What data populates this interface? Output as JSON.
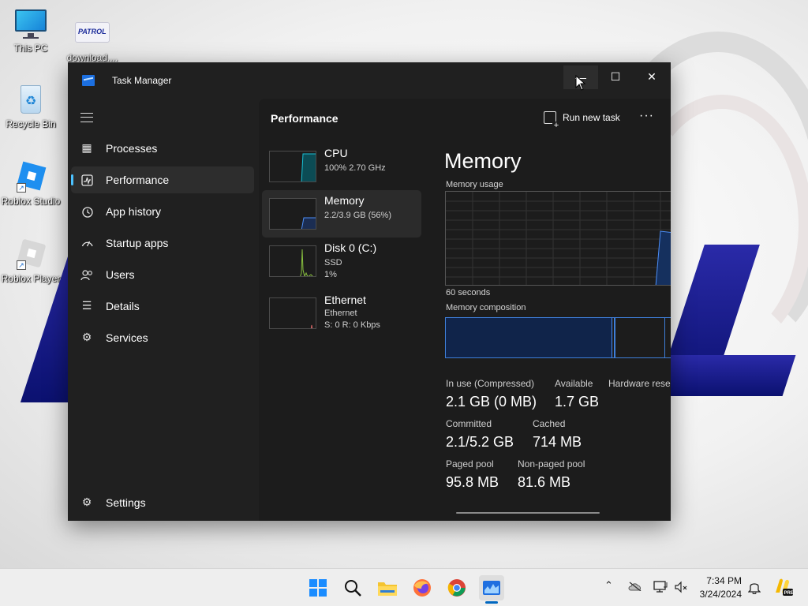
{
  "desktop": {
    "icons": [
      {
        "label": "This PC"
      },
      {
        "label": "download...."
      },
      {
        "label": "Recycle Bin"
      },
      {
        "label": "Roblox Studio"
      },
      {
        "label": "Roblox Player"
      }
    ],
    "wallpaper_logo_text": "PATROL"
  },
  "window": {
    "title": "Task Manager",
    "controls": {
      "minimize": "—",
      "maximize": "☐",
      "close": "✕"
    }
  },
  "sidebar": {
    "items": [
      {
        "label": "Processes",
        "icon": "processes-grid-icon"
      },
      {
        "label": "Performance",
        "icon": "performance-chart-icon",
        "active": true
      },
      {
        "label": "App history",
        "icon": "history-clock-icon"
      },
      {
        "label": "Startup apps",
        "icon": "startup-gauge-icon"
      },
      {
        "label": "Users",
        "icon": "users-icon"
      },
      {
        "label": "Details",
        "icon": "details-list-icon"
      },
      {
        "label": "Services",
        "icon": "services-puzzle-icon"
      }
    ],
    "settings_label": "Settings"
  },
  "header": {
    "title": "Performance",
    "run_new_task": "Run new task",
    "more": "···"
  },
  "resources": [
    {
      "name": "CPU",
      "sub1": "100% 2.70 GHz",
      "sub2": "",
      "color": "#17c1d6"
    },
    {
      "name": "Memory",
      "sub1": "2.2/3.9 GB (56%)",
      "sub2": "",
      "color": "#4c8ef7",
      "active": true
    },
    {
      "name": "Disk 0 (C:)",
      "sub1": "SSD",
      "sub2": "1%",
      "color": "#89c13f"
    },
    {
      "name": "Ethernet",
      "sub1": "Ethernet",
      "sub2": "S: 0 R: 0 Kbps",
      "color": "#d26464"
    }
  ],
  "detail": {
    "title": "Memory",
    "usage_label": "Memory usage",
    "time_label": "60 seconds",
    "composition_label": "Memory composition",
    "stats": [
      {
        "label": "In use (Compressed)",
        "value": "2.1 GB (0 MB)"
      },
      {
        "label": "Available",
        "value": "1.7 GB"
      },
      {
        "label": "Hardware reser",
        "value": ""
      },
      {
        "label": "Committed",
        "value": "2.1/5.2 GB"
      },
      {
        "label": "Cached",
        "value": "714 MB"
      },
      {
        "label": "Paged pool",
        "value": "95.8 MB"
      },
      {
        "label": "Non-paged pool",
        "value": "81.6 MB"
      }
    ]
  },
  "taskbar": {
    "time": "7:34 PM",
    "date": "3/24/2024",
    "pinned": [
      "start-icon",
      "search-icon",
      "file-explorer-icon",
      "firefox-icon",
      "chrome-icon",
      "task-manager-icon"
    ],
    "tray": [
      "chevron-up-icon",
      "onedrive-icon",
      "display-icon",
      "network-volume-icon",
      "notification-bell-icon",
      "copilot-pre-icon"
    ]
  },
  "colors": {
    "accent": "#4cc2ff",
    "memory": "#4c8ef7",
    "window_bg": "#202020"
  }
}
